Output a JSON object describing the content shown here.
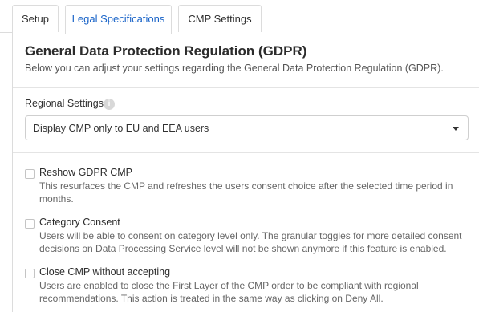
{
  "tabs": [
    {
      "label": "Setup"
    },
    {
      "label": "Legal Specifications",
      "active": true
    },
    {
      "label": "CMP Settings"
    }
  ],
  "section": {
    "title": "General Data Protection Regulation (GDPR)",
    "subtitle": "Below you can adjust your settings regarding the General Data Protection Regulation (GDPR)."
  },
  "regional": {
    "label": "Regional Settings",
    "info_icon": "info-icon",
    "selected": "Display CMP only to EU and EEA users"
  },
  "options": [
    {
      "title": "Reshow GDPR CMP",
      "description": "This resurfaces the CMP and refreshes the users consent choice after the selected time period in months.",
      "checked": false
    },
    {
      "title": "Category Consent",
      "description": "Users will be able to consent on category level only. The granular toggles for more detailed consent decisions on Data Processing Service level will not be shown anymore if this feature is enabled.",
      "checked": false
    },
    {
      "title": "Close CMP without accepting",
      "description": "Users are enabled to close the First Layer of the CMP order to be compliant with regional recommendations. This action is treated in the same way as clicking on Deny All.",
      "checked": false
    }
  ],
  "colors": {
    "active_tab": "#1a64c8",
    "border": "#dcdcdc",
    "text": "#303030"
  }
}
